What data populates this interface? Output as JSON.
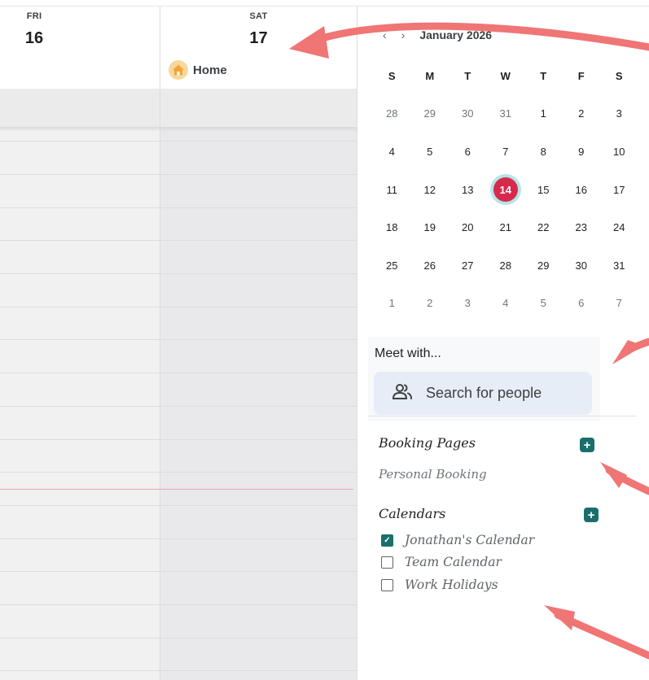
{
  "week": {
    "days": [
      {
        "dow": "FRI",
        "date": "16"
      },
      {
        "dow": "SAT",
        "date": "17"
      }
    ],
    "allday_event": {
      "label": "Home",
      "icon": "house-icon"
    }
  },
  "mini_calendar": {
    "prev_icon": "chevron-left-icon",
    "next_icon": "chevron-right-icon",
    "title": "January 2026",
    "weekday_headers": [
      "S",
      "M",
      "T",
      "W",
      "T",
      "F",
      "S"
    ],
    "weeks": [
      [
        "28",
        "29",
        "30",
        "31",
        "1",
        "2",
        "3"
      ],
      [
        "4",
        "5",
        "6",
        "7",
        "8",
        "9",
        "10"
      ],
      [
        "11",
        "12",
        "13",
        "14",
        "15",
        "16",
        "17"
      ],
      [
        "18",
        "19",
        "20",
        "21",
        "22",
        "23",
        "24"
      ],
      [
        "25",
        "26",
        "27",
        "28",
        "29",
        "30",
        "31"
      ],
      [
        "1",
        "2",
        "3",
        "4",
        "5",
        "6",
        "7"
      ]
    ],
    "today": "14"
  },
  "meet_with": {
    "title": "Meet with...",
    "search_placeholder": "Search for people",
    "icon": "people-icon"
  },
  "booking_pages": {
    "title": "Booking Pages",
    "add_icon": "plus-icon",
    "items": [
      "Personal Booking"
    ]
  },
  "calendars": {
    "title": "Calendars",
    "add_icon": "plus-icon",
    "items": [
      {
        "name": "Jonathan's Calendar",
        "checked": true
      },
      {
        "name": "Team Calendar",
        "checked": false
      },
      {
        "name": "Work Holidays",
        "checked": false
      }
    ]
  },
  "colors": {
    "accent_teal": "#1a6f6b",
    "today_red": "#d62a4d",
    "annotation_arrow": "#f07575"
  }
}
